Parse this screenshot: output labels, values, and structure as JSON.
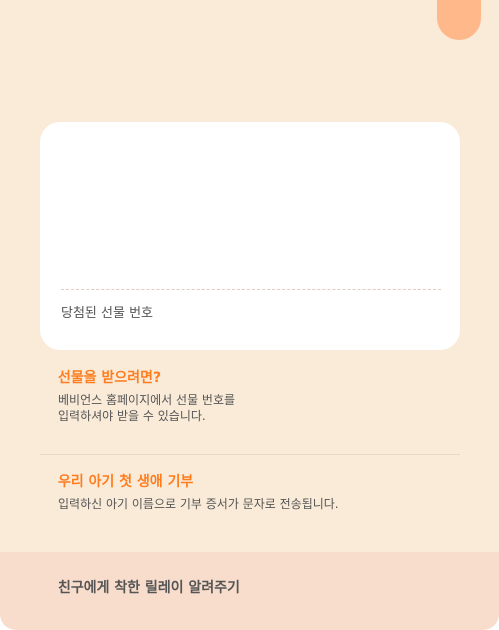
{
  "gift_card": {
    "number_label": "당첨된 선물 번호"
  },
  "how_to_receive": {
    "title": "선물을 받으려면?",
    "description": "베비언스 홈페이지에서 선물 번호를\n입력하셔야 받을 수 있습니다."
  },
  "donation": {
    "title": "우리 아기 첫 생애 기부",
    "description": "입력하신 아기 이름으로 기부 증서가 문자로 전송됩니다."
  },
  "footer": {
    "relay_label": "친구에게 착한 릴레이 알려주기"
  },
  "colors": {
    "background": "#faebd9",
    "accent": "#ff7d1e",
    "corner_tab": "#ffb88a",
    "footer_bar": "#f8ddcc"
  }
}
